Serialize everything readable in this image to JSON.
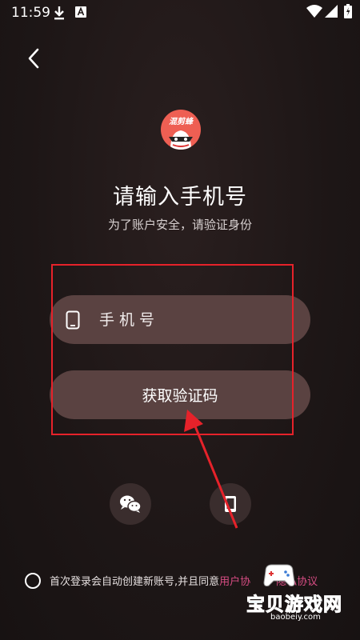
{
  "status_bar": {
    "time": "11:59",
    "icons_left": [
      "download-icon",
      "a-icon"
    ],
    "icons_right": [
      "wifi-icon",
      "signal-icon",
      "battery-icon"
    ]
  },
  "header": {
    "back_icon": "back-arrow-icon"
  },
  "logo": {
    "text": "混剪蜂"
  },
  "title": "请输入手机号",
  "subtitle": "为了账户安全，请验证身份",
  "form": {
    "phone_placeholder": "手机号",
    "phone_value": "",
    "phone_icon": "phone-icon",
    "get_code_label": "获取验证码"
  },
  "alt_login": [
    {
      "icon": "wechat-icon"
    },
    {
      "icon": "mobile-device-icon"
    }
  ],
  "terms": {
    "text": "首次登录会自动创建新账号,并且同意",
    "link1": "用户协",
    "link2": "隐私协议"
  },
  "watermark": {
    "title": "宝贝游戏网",
    "url": "baobeiy.com"
  },
  "colors": {
    "background": "#1d1616",
    "field": "#5a4241",
    "highlight": "#e6222a",
    "link": "#d84d84",
    "logo": "#ee5f53"
  }
}
